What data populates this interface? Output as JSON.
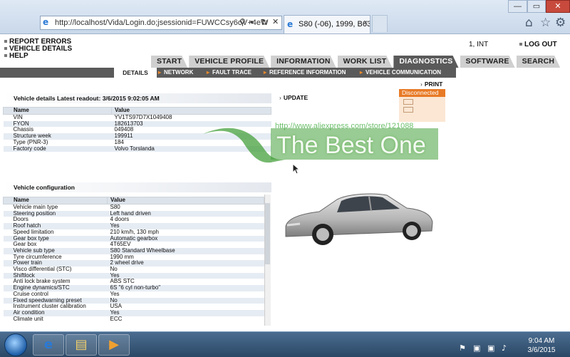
{
  "browser": {
    "back_glyph": "←",
    "forward_glyph": "→",
    "address": "http://localhost/Vida/Login.do;jsessionid=FUWCCsy6oV+4eW",
    "tab_title": "S80 (-06), 1999, B63...",
    "tab_close": "×",
    "search_glyph": "⚲",
    "stop_glyph": "✕",
    "refresh_glyph": "↻",
    "dropdown_glyph": "▾",
    "home_glyph": "⌂",
    "favorites_glyph": "☆",
    "tools_glyph": "⚙",
    "min_glyph": "—",
    "max_glyph": "▭",
    "close_glyph": "✕",
    "icons": [
      "back-icon",
      "forward-icon",
      "ie-icon",
      "search-icon",
      "refresh-icon",
      "home-icon",
      "star-icon",
      "gear-icon"
    ]
  },
  "header": {
    "links": [
      "REPORT ERRORS",
      "VEHICLE DETAILS",
      "HELP"
    ],
    "user": "1, INT",
    "logout": "LOG OUT"
  },
  "main_tabs": [
    "START",
    "VEHICLE PROFILE",
    "INFORMATION",
    "WORK LIST",
    "DIAGNOSTICS",
    "SOFTWARE",
    "SEARCH"
  ],
  "active_tab": "DIAGNOSTICS",
  "subnav": {
    "details": "DETAILS",
    "items": [
      "NETWORK",
      "FAULT TRACE",
      "REFERENCE INFORMATION",
      "VEHICLE COMMUNICATION"
    ],
    "arrow": "▸"
  },
  "actions": {
    "print": "PRINT",
    "update": "UPDATE",
    "arrow": "›"
  },
  "status": {
    "text": "Disconnected",
    "color": "#e87a26"
  },
  "vehicle_details": {
    "title": "Vehicle details    Latest readout: 3/6/2015 9:02:05 AM",
    "col_name": "Name",
    "col_value": "Value",
    "rows": [
      [
        "VIN",
        "YV1TS97D7X1049408"
      ],
      [
        "FYON",
        "182613703"
      ],
      [
        "Chassis",
        "049408"
      ],
      [
        "Structure week",
        "199911"
      ],
      [
        "Type (PNR-3)",
        "184"
      ],
      [
        "Factory code",
        "Volvo Torslanda"
      ]
    ]
  },
  "vehicle_configuration": {
    "title": "Vehicle configuration",
    "col_name": "Name",
    "col_value": "Value",
    "rows": [
      [
        "Vehicle main type",
        "S80"
      ],
      [
        "Steering position",
        "Left hand driven"
      ],
      [
        "Doors",
        "4 doors"
      ],
      [
        "Roof hatch",
        "Yes"
      ],
      [
        "Speed limitation",
        "210 km/h, 130 mph"
      ],
      [
        "Gear box type",
        "Automatic gearbox"
      ],
      [
        "Gear box",
        "4T65EV"
      ],
      [
        "Vehicle sub type",
        "S80 Standard Wheelbase"
      ],
      [
        "Tyre circumference",
        "1990 mm"
      ],
      [
        "Power train",
        "2 wheel drive"
      ],
      [
        "Visco differential (STC)",
        "No"
      ],
      [
        "Shiftlock",
        "Yes"
      ],
      [
        "Anti lock brake system",
        "ABS STC"
      ],
      [
        "Engine dynamics/STC",
        "6S \"6 cyl non-turbo\""
      ],
      [
        "Cruise control",
        "Yes"
      ],
      [
        "Fixed speedwarning preset",
        "No"
      ],
      [
        "Instrument cluster calibration",
        "USA"
      ],
      [
        "Air condition",
        "Yes"
      ],
      [
        "Climate unit",
        "ECC"
      ]
    ]
  },
  "watermark": {
    "url": "http://www.aliexpress.com/store/121088",
    "text": "The Best One"
  },
  "taskbar": {
    "ie_glyph": "e",
    "explorer_glyph": "▤",
    "media_glyph": "▶",
    "flag_glyph": "⚑",
    "volume_glyph": "♪",
    "time": "9:04 AM",
    "date": "3/6/2015"
  }
}
